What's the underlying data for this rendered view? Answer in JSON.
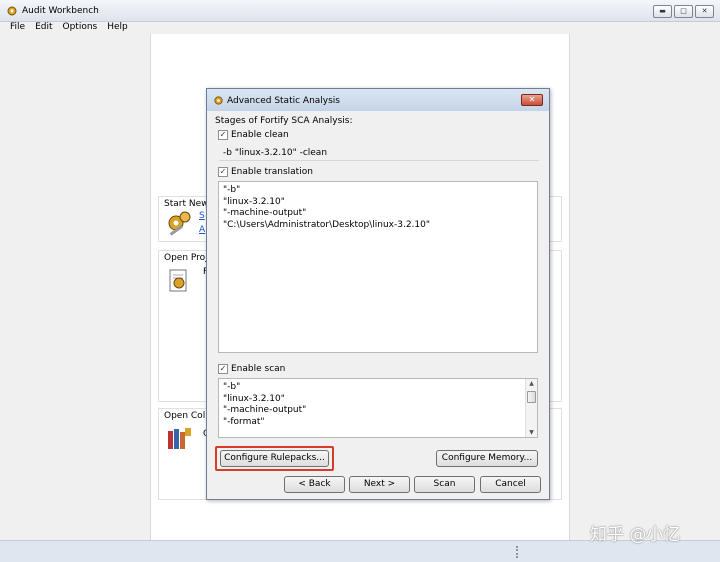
{
  "window": {
    "title": "Audit Workbench",
    "controls": {
      "minimize": "▬",
      "maximize": "□",
      "close": "✕"
    }
  },
  "menu": [
    "File",
    "Edit",
    "Options",
    "Help"
  ],
  "background": {
    "start_new_title": "Start New",
    "start_new_links": [
      "S",
      "A"
    ],
    "open_project_title": "Open Proje",
    "open_project_item": "F",
    "open_collab_title": "Open Colla",
    "open_collab_item": "C"
  },
  "dialog": {
    "title": "Advanced Static Analysis",
    "stages_label": "Stages of Fortify SCA Analysis:",
    "enable_clean": {
      "label": "Enable clean",
      "checked": true,
      "command": "-b \"linux-3.2.10\" -clean"
    },
    "enable_translation": {
      "label": "Enable translation",
      "checked": true,
      "lines": [
        "\"-b\"",
        "\"linux-3.2.10\"",
        "\"-machine-output\"",
        "\"C:\\Users\\Administrator\\Desktop\\linux-3.2.10\""
      ]
    },
    "enable_scan": {
      "label": "Enable scan",
      "checked": true,
      "lines": [
        "\"-b\"",
        "\"linux-3.2.10\"",
        "\"-machine-output\"",
        "\"-format\""
      ]
    },
    "buttons": {
      "configure_rulepacks": "Configure Rulepacks...",
      "configure_memory": "Configure Memory...",
      "back": "< Back",
      "next": "Next >",
      "scan": "Scan",
      "cancel": "Cancel"
    },
    "highlight_color": "#d83a2c"
  },
  "watermark": "知乎 @小忆"
}
